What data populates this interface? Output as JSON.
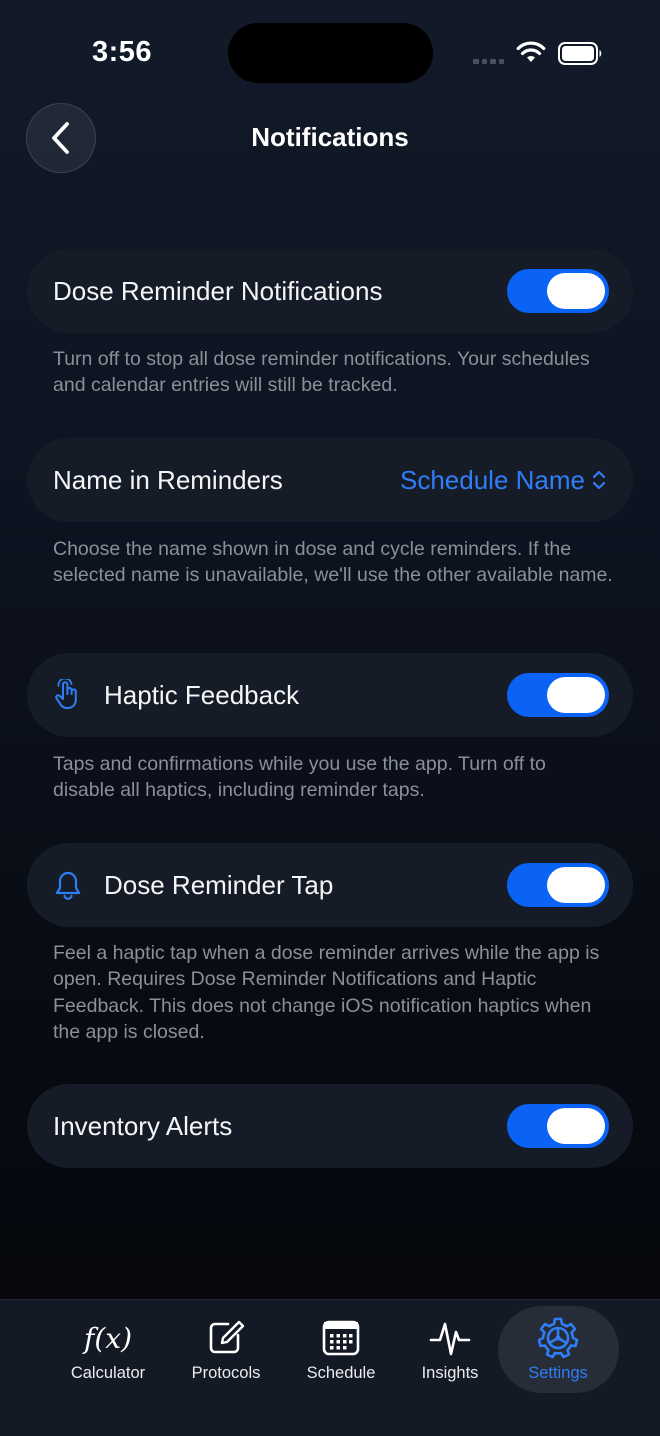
{
  "status_bar": {
    "time": "3:56"
  },
  "header": {
    "title": "Notifications",
    "back_icon": "chevron-left-icon"
  },
  "settings": {
    "dose_reminder_notifications": {
      "label": "Dose Reminder Notifications",
      "enabled": true,
      "caption": "Turn off to stop all dose reminder notifications. Your schedules and calendar entries will still be tracked."
    },
    "name_in_reminders": {
      "label": "Name in Reminders",
      "value": "Schedule Name",
      "caption": "Choose the name shown in dose and cycle reminders. If the selected name is unavailable, we'll use the other available name."
    },
    "haptic_feedback": {
      "label": "Haptic Feedback",
      "icon": "hand-tap-icon",
      "enabled": true,
      "caption": "Taps and confirmations while you use the app. Turn off to disable all haptics, including reminder taps."
    },
    "dose_reminder_tap": {
      "label": "Dose Reminder Tap",
      "icon": "bell-icon",
      "enabled": true,
      "caption": "Feel a haptic tap when a dose reminder arrives while the app is open. Requires Dose Reminder Notifications and Haptic Feedback. This does not change iOS notification haptics when the app is closed."
    },
    "inventory_alerts": {
      "label": "Inventory Alerts",
      "enabled": true
    }
  },
  "tab_bar": {
    "active": "Settings",
    "tabs": [
      {
        "label": "Calculator",
        "icon": "function-icon",
        "icon_text": "f(x)"
      },
      {
        "label": "Protocols",
        "icon": "edit-icon"
      },
      {
        "label": "Schedule",
        "icon": "calendar-icon"
      },
      {
        "label": "Insights",
        "icon": "pulse-icon"
      },
      {
        "label": "Settings",
        "icon": "gear-icon"
      }
    ]
  },
  "colors": {
    "accent": "#0a63f5",
    "link": "#2f7ef7",
    "card": "#161c27",
    "caption": "#8a8f98"
  }
}
